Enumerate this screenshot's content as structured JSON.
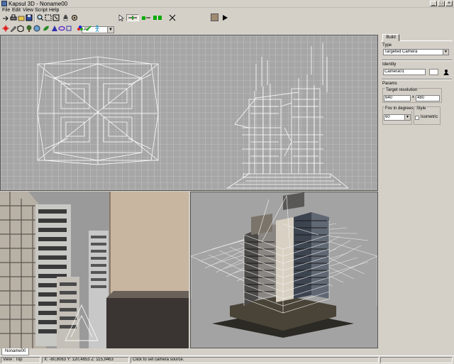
{
  "window": {
    "title": "Kapsul 3D - Noname00"
  },
  "menu": [
    {
      "label": "File"
    },
    {
      "label": "Edit"
    },
    {
      "label": "View"
    },
    {
      "label": "Script"
    },
    {
      "label": "Help"
    }
  ],
  "toolbar": {
    "filter_value": "All"
  },
  "panel": {
    "tab_label": "Build",
    "type_label": "Type",
    "type_value": "Targeted Camera",
    "identity_label": "Identity",
    "identity_value": "Camera01",
    "params_label": "Params",
    "target_res_label": "Target resolution",
    "res_width": "640",
    "res_x": "x",
    "res_height": "480",
    "fov_label": "Fov in degrees",
    "fov_value": "60",
    "style_label": "Style",
    "isometric_label": "Isometric",
    "isometric_checked": false
  },
  "tabs": [
    {
      "label": "Noname00"
    }
  ],
  "status": {
    "view": "View : Top",
    "coords": "X: -80,8063 Y: 120,4853 Z: 115,9463",
    "hint": "Click to set camera source."
  },
  "colors": {
    "background": "#d4d0c8",
    "viewport_grid": "#ffffff",
    "viewport_bg": "#a6a6a6"
  }
}
